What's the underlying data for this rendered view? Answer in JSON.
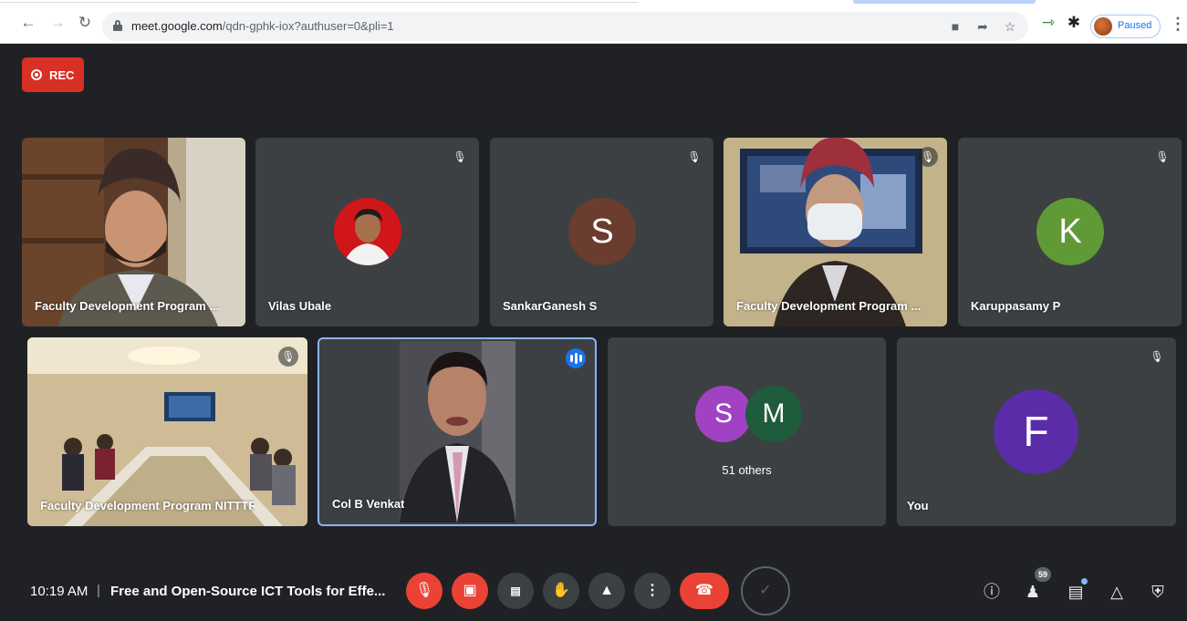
{
  "browser": {
    "url_host": "meet.google.com",
    "url_path": "/qdn-gphk-iox?authuser=0&pli=1",
    "profile_status": "Paused"
  },
  "recording": {
    "label": "REC"
  },
  "tiles": [
    {
      "name": "Faculty Development Program ...",
      "muted": false
    },
    {
      "name": "Vilas Ubale",
      "muted": true
    },
    {
      "name": "SankarGanesh S",
      "muted": true,
      "initial": "S",
      "color": "#6b3d2e"
    },
    {
      "name": "Faculty Development Program ...",
      "muted": true
    },
    {
      "name": "Karuppasamy P",
      "muted": true,
      "initial": "K",
      "color": "#5f9a37"
    },
    {
      "name": "Faculty Development Program NITTTR Ch...",
      "muted": true
    },
    {
      "name": "Col B Venkat",
      "speaking": true
    },
    {
      "name": "",
      "others_label": "51 others",
      "initials": [
        "S",
        "M"
      ],
      "colors": [
        "#a142c4",
        "#1e5c3b"
      ]
    },
    {
      "name": "You",
      "muted": true,
      "initial": "F",
      "color": "#5b2ca8"
    }
  ],
  "bottom_bar": {
    "time": "10:19 AM",
    "separator": "|",
    "meeting_title": "Free and Open-Source ICT Tools for Effe...",
    "participants_count": "59"
  },
  "colors": {
    "background": "#202124",
    "tile": "#3c4043",
    "danger": "#ea4335",
    "accent": "#1a73e8"
  }
}
